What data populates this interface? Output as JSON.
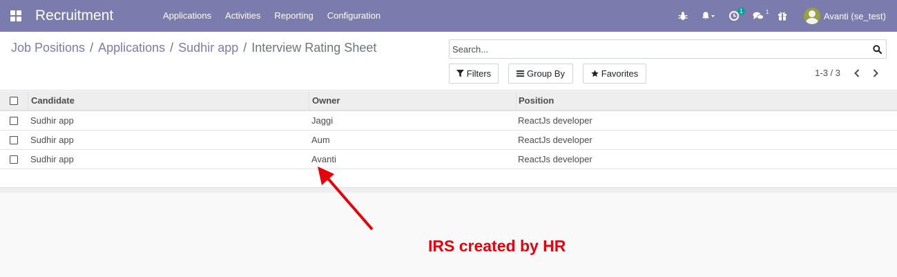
{
  "navbar": {
    "app_title": "Recruitment",
    "menu": [
      "Applications",
      "Activities",
      "Reporting",
      "Configuration"
    ],
    "icons": [
      "bug-icon",
      "bell-icon",
      "clock-icon",
      "chat-icon",
      "gift-icon"
    ],
    "activity_badge": "1",
    "messages_badge": "1",
    "user_name": "Avanti (se_test)",
    "bg_color": "#7c7bad"
  },
  "breadcrumb": {
    "items": [
      "Job Positions",
      "Applications",
      "Sudhir app"
    ],
    "separator": "/",
    "current": "Interview Rating Sheet"
  },
  "search": {
    "placeholder": "Search..."
  },
  "filters": {
    "filters_label": "Filters",
    "group_by_label": "Group By",
    "favorites_label": "Favorites"
  },
  "pager": {
    "text": "1-3 / 3"
  },
  "table": {
    "columns": [
      "Candidate",
      "Owner",
      "Position"
    ],
    "rows": [
      {
        "candidate": "Sudhir app",
        "owner": "Jaggi",
        "position": "ReactJs developer"
      },
      {
        "candidate": "Sudhir app",
        "owner": "Aum",
        "position": "ReactJs developer"
      },
      {
        "candidate": "Sudhir app",
        "owner": "Avanti",
        "position": "ReactJs developer"
      }
    ]
  },
  "annotation": {
    "text": "IRS created by HR",
    "color": "#e8000a"
  }
}
